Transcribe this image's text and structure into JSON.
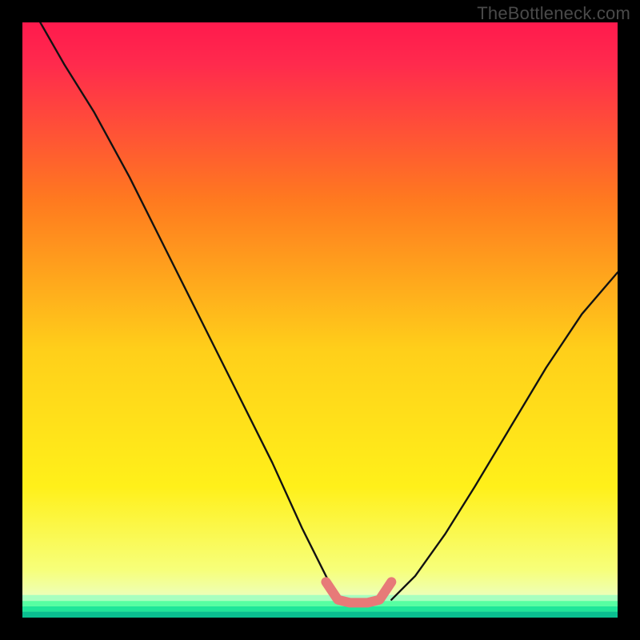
{
  "watermark": "TheBottleneck.com",
  "colors": {
    "frame_black": "#000000",
    "salmon_accent": "#e77a78",
    "curve_stroke": "#121212",
    "grad_top": "#ff1a4d",
    "grad_mid1": "#ff8a1a",
    "grad_mid2": "#ffd21a",
    "grad_low": "#f6ff6a",
    "green1": "#9dffb0",
    "green2": "#3bff97",
    "green3": "#16e391",
    "green4": "#0aba8c"
  },
  "chart_data": {
    "type": "line",
    "title": "",
    "xlabel": "",
    "ylabel": "",
    "xlim": [
      0,
      100
    ],
    "ylim": [
      0,
      100
    ],
    "grid": false,
    "legend": null,
    "annotations": [],
    "series": [
      {
        "name": "left-curve",
        "x": [
          3,
          7,
          12,
          18,
          24,
          30,
          36,
          42,
          47,
          51,
          53
        ],
        "y": [
          100,
          93,
          85,
          74,
          62,
          50,
          38,
          26,
          15,
          7,
          3
        ]
      },
      {
        "name": "right-curve",
        "x": [
          62,
          66,
          71,
          76,
          82,
          88,
          94,
          100
        ],
        "y": [
          3,
          7,
          14,
          22,
          32,
          42,
          51,
          58
        ]
      },
      {
        "name": "valley-accent",
        "x": [
          51,
          53,
          55,
          58,
          60,
          62
        ],
        "y": [
          6,
          3,
          2.5,
          2.5,
          3,
          6
        ],
        "stroke": "salmon",
        "width": 12
      }
    ],
    "notes": "x and y are normalized 0-100 inside the inner plot box. y is measured from the bottom green band upward (0 = bottom of gradient area, 100 = top of gradient area). The background is a vertical red→orange→yellow→pale-yellow gradient with thin green bands near the very bottom."
  }
}
